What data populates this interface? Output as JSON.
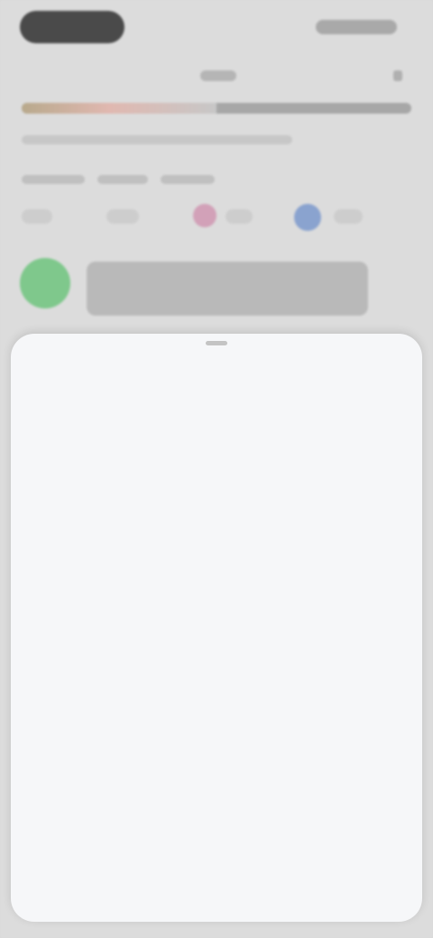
{
  "sheet": {
    "groups": [
      {
        "items": [
          {
            "label": "",
            "value": ""
          },
          {
            "label": "",
            "value": ""
          }
        ]
      },
      {
        "items": [
          {
            "label": "",
            "value": ""
          },
          {
            "label": "",
            "value": ""
          }
        ]
      },
      {
        "items": [
          {
            "label": "",
            "value": ""
          },
          {
            "label": "",
            "value": ""
          }
        ]
      },
      {
        "items": [
          {
            "label": "",
            "value": ""
          }
        ]
      },
      {
        "items": [
          {
            "label": "",
            "value": ""
          },
          {
            "label": "",
            "value": ""
          },
          {
            "label": "",
            "value": ""
          }
        ]
      }
    ]
  },
  "colors": {
    "status_pill": "#4a4a4a",
    "sheet_bg": "#f6f7f9",
    "avatar_green": "#7fc88c",
    "dot_pink": "#d2a1b8",
    "dot_blue": "#8aa3cf"
  },
  "progress": {
    "fraction": 0.5
  }
}
